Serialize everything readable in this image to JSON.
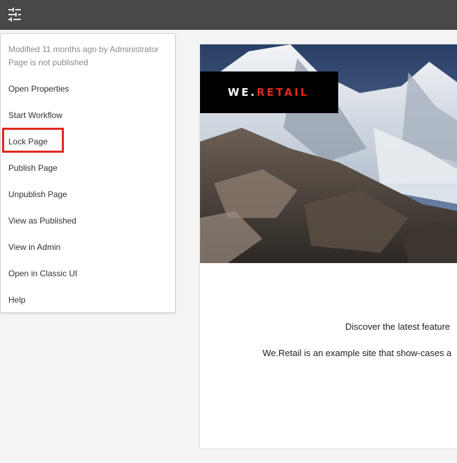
{
  "toolbar": {
    "settings_icon": "sliders-icon"
  },
  "menu": {
    "modified": "Modified 11 months ago by Administrator",
    "status": "Page is not published",
    "items": [
      "Open Properties",
      "Start Workflow",
      "Lock Page",
      "Publish Page",
      "Unpublish Page",
      "View as Published",
      "View in Admin",
      "Open in Classic UI",
      "Help"
    ],
    "highlight_color": "#e0281a"
  },
  "preview": {
    "logo": {
      "part1": "WE.",
      "part2": "RETAIL"
    },
    "line1": "Discover the latest feature",
    "line2": "We.Retail is an example site that show-cases a"
  }
}
